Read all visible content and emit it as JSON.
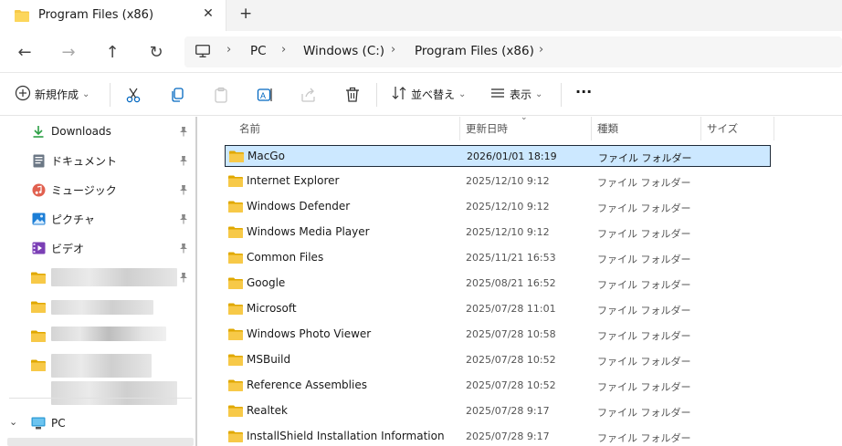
{
  "window": {
    "tab_title": "Program Files (x86)",
    "close_glyph": "✕",
    "new_tab_glyph": "+"
  },
  "nav": {
    "back_glyph": "←",
    "forward_glyph": "→",
    "up_glyph": "↑",
    "refresh_glyph": "↻"
  },
  "breadcrumb": {
    "separator": "›",
    "items": [
      "PC",
      "Windows (C:)",
      "Program Files (x86)"
    ]
  },
  "toolbar": {
    "new_label": "新規作成",
    "sort_label": "並べ替え",
    "view_label": "表示",
    "more_glyph": "···",
    "chevron_glyph": "⌄"
  },
  "sidebar": {
    "items": [
      {
        "label": "Downloads",
        "icon": "download-icon"
      },
      {
        "label": "ドキュメント",
        "icon": "document-icon"
      },
      {
        "label": "ミュージック",
        "icon": "music-icon"
      },
      {
        "label": "ピクチャ",
        "icon": "picture-icon"
      },
      {
        "label": "ビデオ",
        "icon": "video-icon"
      }
    ],
    "pc_label": "PC",
    "pin_glyph": "📌"
  },
  "columns": {
    "name": "名前",
    "date": "更新日時",
    "type": "種類",
    "size": "サイズ"
  },
  "files": [
    {
      "name": "MacGo",
      "date": "2026/01/01 18:19",
      "type": "ファイル フォルダー"
    },
    {
      "name": "Internet Explorer",
      "date": "2025/12/10 9:12",
      "type": "ファイル フォルダー"
    },
    {
      "name": "Windows Defender",
      "date": "2025/12/10 9:12",
      "type": "ファイル フォルダー"
    },
    {
      "name": "Windows Media Player",
      "date": "2025/12/10 9:12",
      "type": "ファイル フォルダー"
    },
    {
      "name": "Common Files",
      "date": "2025/11/21 16:53",
      "type": "ファイル フォルダー"
    },
    {
      "name": "Google",
      "date": "2025/08/21 16:52",
      "type": "ファイル フォルダー"
    },
    {
      "name": "Microsoft",
      "date": "2025/07/28 11:01",
      "type": "ファイル フォルダー"
    },
    {
      "name": "Windows Photo Viewer",
      "date": "2025/07/28 10:58",
      "type": "ファイル フォルダー"
    },
    {
      "name": "MSBuild",
      "date": "2025/07/28 10:52",
      "type": "ファイル フォルダー"
    },
    {
      "name": "Reference Assemblies",
      "date": "2025/07/28 10:52",
      "type": "ファイル フォルダー"
    },
    {
      "name": "Realtek",
      "date": "2025/07/28 9:17",
      "type": "ファイル フォルダー"
    },
    {
      "name": "InstallShield Installation Information",
      "date": "2025/07/28 9:17",
      "type": "ファイル フォルダー"
    }
  ],
  "colors": {
    "folder": "#f7c948",
    "folder_dark": "#e0a800",
    "selection": "#cce8ff",
    "accent": "#0067c0"
  }
}
